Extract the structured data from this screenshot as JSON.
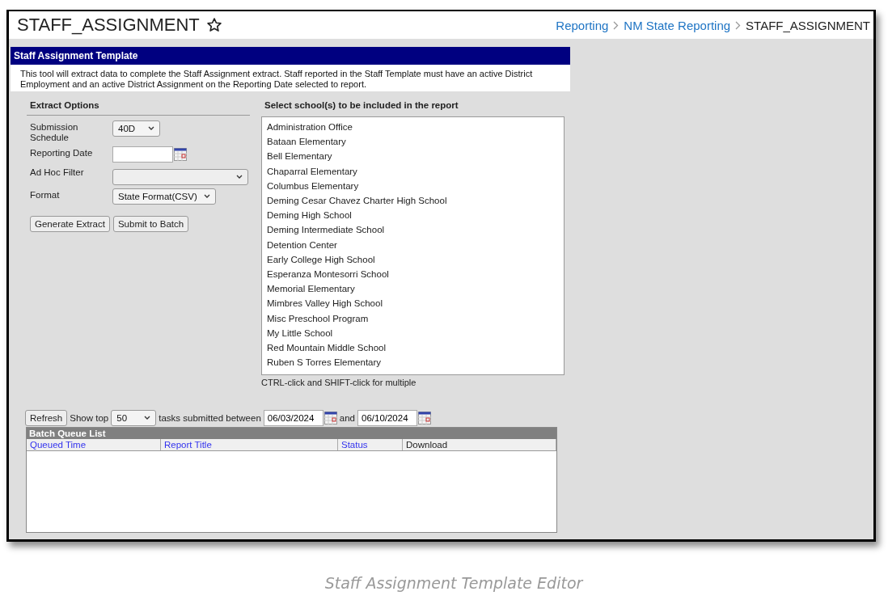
{
  "header": {
    "title": "STAFF_ASSIGNMENT",
    "breadcrumbs": [
      {
        "label": "Reporting",
        "kind": "link"
      },
      {
        "label": "NM State Reporting",
        "kind": "link"
      },
      {
        "label": "STAFF_ASSIGNMENT",
        "kind": "current"
      }
    ]
  },
  "panel": {
    "title": "Staff Assignment Template",
    "description": "This tool will extract data to complete the Staff Assignment extract. Staff reported in the Staff Template must have an active District Employment and an active District Assignment on the Reporting Date selected to report."
  },
  "extract_options": {
    "heading": "Extract Options",
    "fields": [
      {
        "kind": "select",
        "label": "Submission Schedule",
        "value": "40D"
      },
      {
        "kind": "date",
        "label": "Reporting Date"
      },
      {
        "kind": "select",
        "label": "Ad Hoc Filter"
      },
      {
        "kind": "select",
        "label": "Format",
        "value": "State Format(CSV)"
      }
    ],
    "buttons": [
      "Generate Extract",
      "Submit to Batch"
    ]
  },
  "schools": {
    "heading": "Select school(s) to be included in the report",
    "items": [
      {
        "label": "Administration Office",
        "selected": false
      },
      {
        "label": "Bataan Elementary",
        "selected": false
      },
      {
        "label": "Bell Elementary",
        "selected": false
      },
      {
        "label": "Chaparral Elementary",
        "selected": false
      },
      {
        "label": "Columbus Elementary",
        "selected": false
      },
      {
        "label": "Deming Cesar Chavez Charter High School",
        "selected": false
      },
      {
        "label": "Deming High School",
        "selected": false
      },
      {
        "label": "Deming Intermediate School",
        "selected": false
      },
      {
        "label": "Detention Center",
        "selected": false
      },
      {
        "label": "Early College High School",
        "selected": false
      },
      {
        "label": "Esperanza Montesorri School",
        "selected": false
      },
      {
        "label": "Memorial Elementary",
        "selected": false
      },
      {
        "label": "Mimbres Valley High School",
        "selected": false
      },
      {
        "label": "Misc Preschool Program",
        "selected": false
      },
      {
        "label": "My Little School",
        "selected": false
      },
      {
        "label": "Red Mountain Middle School",
        "selected": false
      },
      {
        "label": "Ruben S Torres Elementary",
        "selected": false
      }
    ],
    "hint": "CTRL-click and SHIFT-click for multiple"
  },
  "batch": {
    "refresh_button": "Refresh",
    "show_top_label": "Show top",
    "show_top_value": "50",
    "between_label": "tasks submitted between",
    "from_date": "06/03/2024",
    "and_label": "and",
    "to_date": "06/10/2024",
    "list_title": "Batch Queue List",
    "columns": [
      {
        "label": "Queued Time",
        "kind": "link"
      },
      {
        "label": "Report Title",
        "kind": "link"
      },
      {
        "label": "Status",
        "kind": "link"
      },
      {
        "label": "Download",
        "kind": "plain"
      }
    ]
  },
  "caption": "Staff Assignment Template Editor"
}
